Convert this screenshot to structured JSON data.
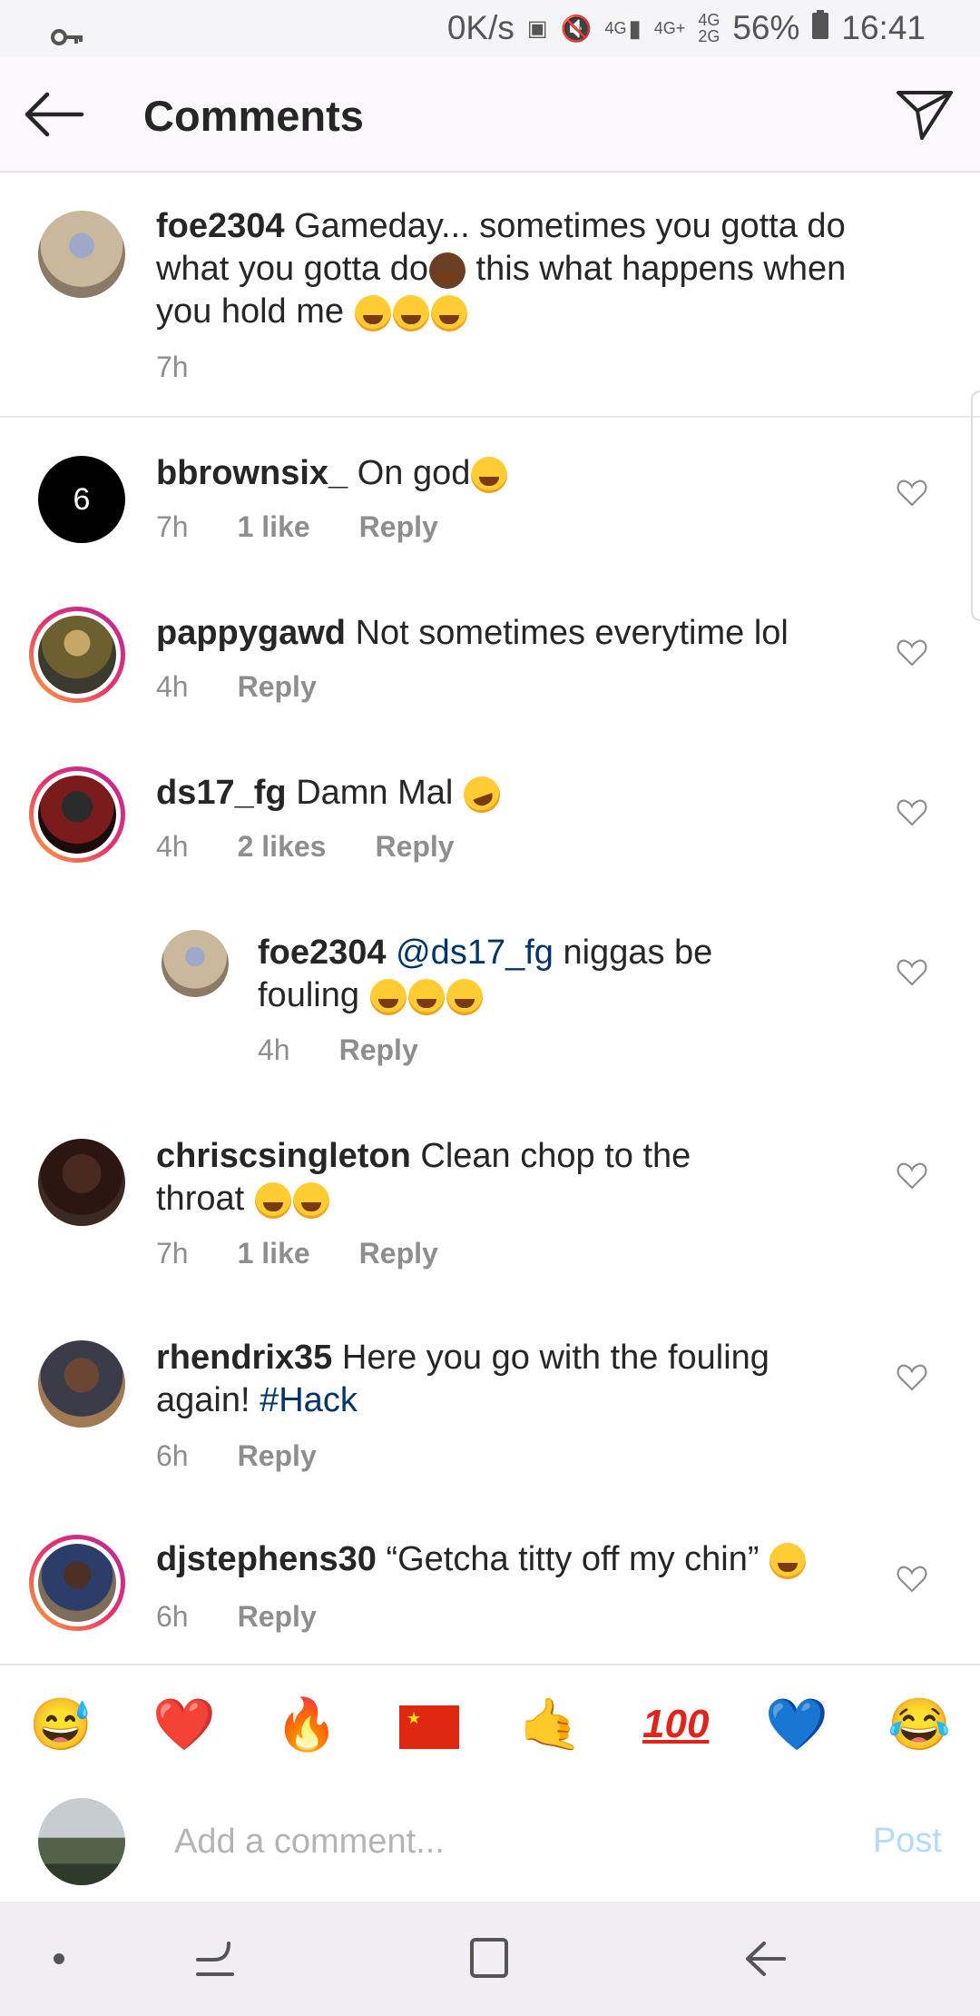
{
  "status_bar": {
    "speed": "0K/s",
    "network_1": "4G",
    "network_2": "4G+",
    "network_3": "4G",
    "network_4": "2G",
    "battery": "56%",
    "time": "16:41"
  },
  "header": {
    "title": "Comments"
  },
  "caption": {
    "username": "foe2304",
    "text_1": "Gameday... sometimes you gotta do",
    "text_2": "what you gotta do",
    "text_3": " this what happens when",
    "text_4": "you hold me",
    "time": "7h"
  },
  "comments": [
    {
      "username": "bbrownsix_",
      "text": "On god",
      "time": "7h",
      "likes": "1 like",
      "reply": "Reply",
      "avatar_text": "6"
    },
    {
      "username": "pappygawd",
      "text": "Not sometimes everytime lol",
      "time": "4h",
      "reply": "Reply"
    },
    {
      "username": "ds17_fg",
      "text": "Damn Mal",
      "time": "4h",
      "likes": "2 likes",
      "reply": "Reply"
    },
    {
      "username": "foe2304",
      "mention": "@ds17_fg",
      "text_1": "niggas be",
      "text_2": "fouling",
      "time": "4h",
      "reply": "Reply"
    },
    {
      "username": "chriscsingleton",
      "text_1": "Clean chop to the",
      "text_2": "throat",
      "time": "7h",
      "likes": "1 like",
      "reply": "Reply"
    },
    {
      "username": "rhendrix35",
      "text_1": "Here you go with the fouling",
      "text_2": "again!",
      "hashtag": "#Hack",
      "time": "6h",
      "reply": "Reply"
    },
    {
      "username": "djstephens30",
      "text": "“Getcha titty off my chin”",
      "time": "6h",
      "reply": "Reply"
    }
  ],
  "reactions": [
    "grinning-sweat",
    "red-heart",
    "fire",
    "china-flag",
    "call-me-hand",
    "hundred-points",
    "blue-heart",
    "tears-of-joy"
  ],
  "composer": {
    "placeholder": "Add a comment...",
    "post_label": "Post"
  },
  "colors": {
    "link": "#003569",
    "post_disabled": "#b3dbff",
    "meta": "#8e8e8e"
  }
}
